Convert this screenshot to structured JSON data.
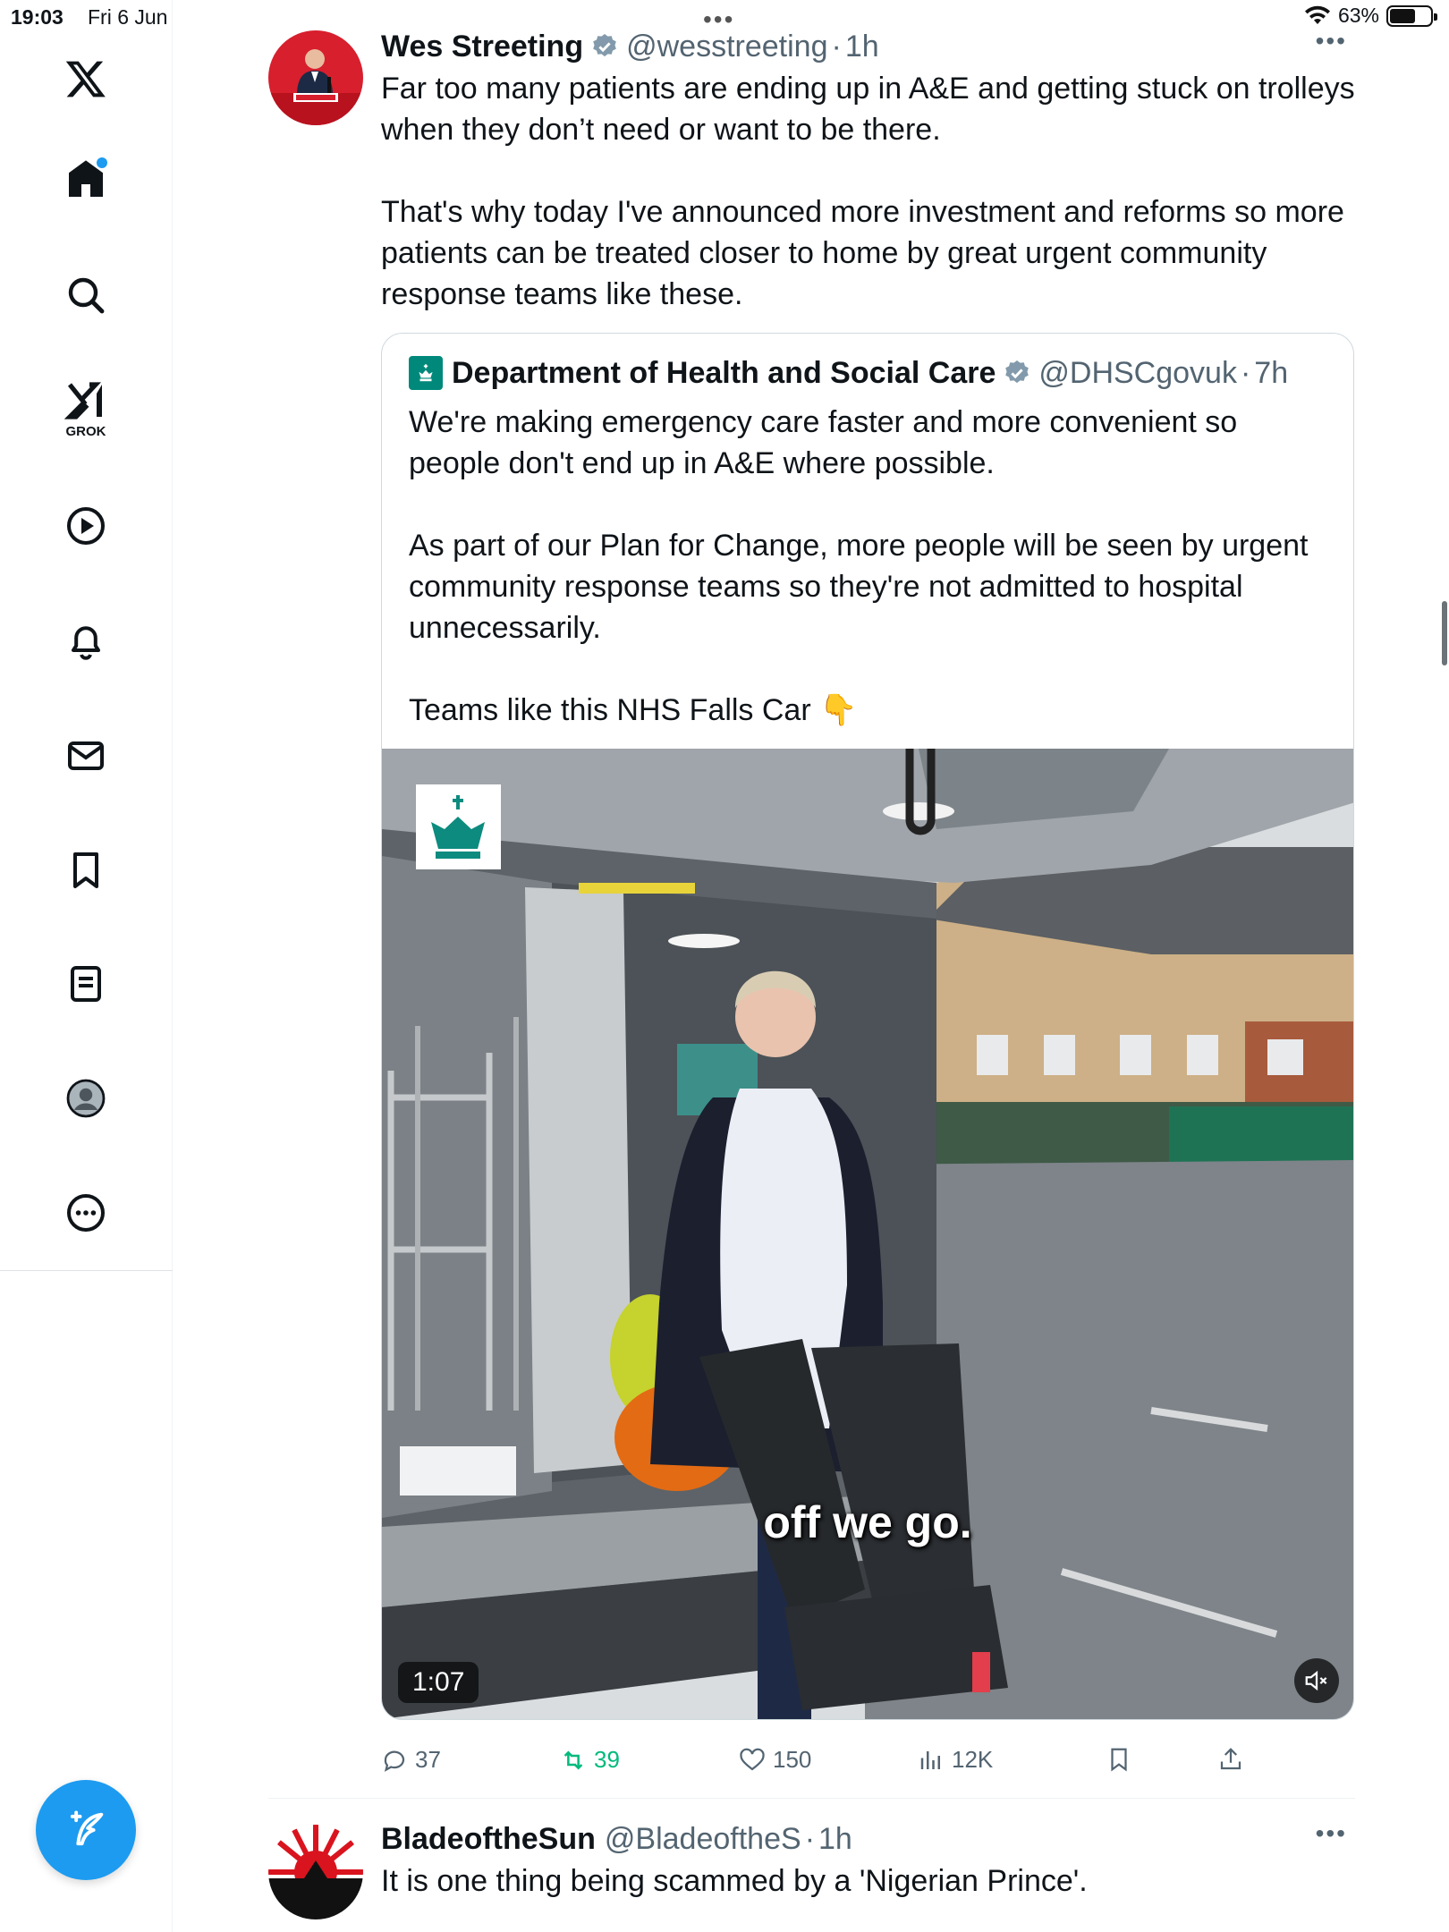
{
  "status_bar": {
    "time": "19:03",
    "date": "Fri 6 Jun",
    "battery": "63%",
    "battery_level": 0.63,
    "dots": "•••"
  },
  "sidebar": {
    "items": [
      {
        "icon": "x-logo-icon"
      },
      {
        "icon": "home-icon"
      },
      {
        "icon": "search-icon"
      },
      {
        "icon": "grok-icon",
        "label": "GROK"
      },
      {
        "icon": "video-play-icon"
      },
      {
        "icon": "bell-icon"
      },
      {
        "icon": "mail-icon"
      },
      {
        "icon": "bookmark-icon"
      },
      {
        "icon": "lists-icon"
      },
      {
        "icon": "profile-icon"
      },
      {
        "icon": "more-circle-icon"
      }
    ],
    "compose_icon": "compose-icon"
  },
  "tweet1": {
    "name": "Wes Streeting",
    "handle": "@wesstreeting",
    "dot": "·",
    "time": "1h",
    "more": "•••",
    "paragraphs": [
      "Far too many patients are ending up in A&E and getting stuck on trolleys when they don’t need or want to be there.",
      "That's why today I've announced more investment and reforms so more patients can be treated closer to home by great urgent community response teams like these."
    ],
    "quote": {
      "name": "Department of Health and Social Care",
      "handle": "@DHSCgovuk",
      "dot": "·",
      "time": "7h",
      "paragraphs": [
        "We're making emergency care faster and more convenient so people don't end up in A&E where possible.",
        "As part of our Plan for Change, more people will be seen by urgent community response teams so they're not admitted to hospital unnecessarily.",
        "Teams like this NHS Falls Car 👇"
      ],
      "video": {
        "caption": "off we go.",
        "duration": "1:07"
      }
    },
    "stats": {
      "replies": "37",
      "reposts": "39",
      "likes": "150",
      "views": "12K"
    },
    "colors": {
      "repost_active": "#00ba7c",
      "accent": "#1d9bf0"
    }
  },
  "tweet2": {
    "name": "BladeoftheSun",
    "handle": "@BladeoftheS",
    "dot": "·",
    "time": "1h",
    "more": "•••",
    "text": "It is one thing being scammed by a 'Nigerian Prince'."
  }
}
